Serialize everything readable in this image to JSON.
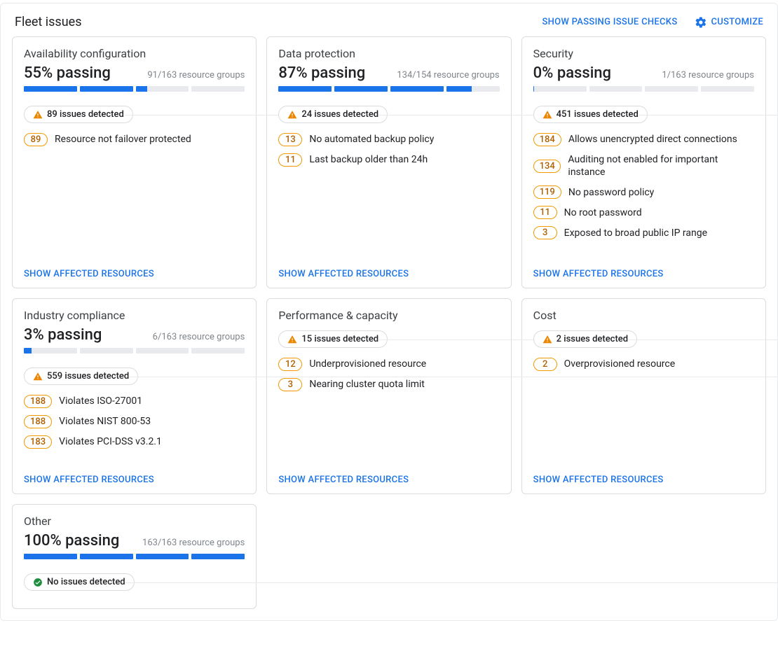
{
  "header": {
    "title": "Fleet issues",
    "show_passing_label": "SHOW PASSING ISSUE CHECKS",
    "customize_label": "CUSTOMIZE"
  },
  "footer_link_label": "SHOW AFFECTED RESOURCES",
  "cards": {
    "availability": {
      "title": "Availability configuration",
      "stat": "55% passing",
      "sub": "91/163 resource groups",
      "segments": [
        100,
        100,
        22,
        0
      ],
      "chip": "89 issues detected",
      "chip_state": "warn",
      "issues": [
        {
          "count": "89",
          "text": "Resource not failover protected"
        }
      ]
    },
    "data_protection": {
      "title": "Data protection",
      "stat": "87% passing",
      "sub": "134/154 resource groups",
      "segments": [
        100,
        100,
        100,
        48
      ],
      "chip": "24 issues detected",
      "chip_state": "warn",
      "issues": [
        {
          "count": "13",
          "text": "No automated backup policy"
        },
        {
          "count": "11",
          "text": "Last backup older than 24h"
        }
      ]
    },
    "security": {
      "title": "Security",
      "stat": "0% passing",
      "sub": "1/163 resource groups",
      "segments": [
        2,
        0,
        0,
        0
      ],
      "chip": "451 issues detected",
      "chip_state": "warn",
      "issues": [
        {
          "count": "184",
          "text": "Allows unencrypted direct connections"
        },
        {
          "count": "134",
          "text": "Auditing not enabled for important instance"
        },
        {
          "count": "119",
          "text": "No password policy"
        },
        {
          "count": "11",
          "text": "No root password"
        },
        {
          "count": "3",
          "text": "Exposed to broad public IP range"
        }
      ]
    },
    "compliance": {
      "title": "Industry compliance",
      "stat": "3% passing",
      "sub": "6/163 resource groups",
      "segments": [
        14,
        0,
        0,
        0
      ],
      "chip": "559 issues detected",
      "chip_state": "warn",
      "issues": [
        {
          "count": "188",
          "text": "Violates ISO-27001"
        },
        {
          "count": "188",
          "text": "Violates NIST 800-53"
        },
        {
          "count": "183",
          "text": "Violates PCI-DSS v3.2.1"
        }
      ]
    },
    "performance": {
      "title": "Performance & capacity",
      "chip": "15 issues detected",
      "chip_state": "warn",
      "issues": [
        {
          "count": "12",
          "text": "Underprovisioned resource"
        },
        {
          "count": "3",
          "text": "Nearing cluster quota limit"
        }
      ]
    },
    "cost": {
      "title": "Cost",
      "chip": "2 issues detected",
      "chip_state": "warn",
      "issues": [
        {
          "count": "2",
          "text": "Overprovisioned resource"
        }
      ]
    },
    "other": {
      "title": "Other",
      "stat": "100% passing",
      "sub": "163/163 resource groups",
      "segments": [
        100,
        100,
        100,
        100
      ],
      "chip": "No issues detected",
      "chip_state": "ok",
      "issues": []
    }
  }
}
